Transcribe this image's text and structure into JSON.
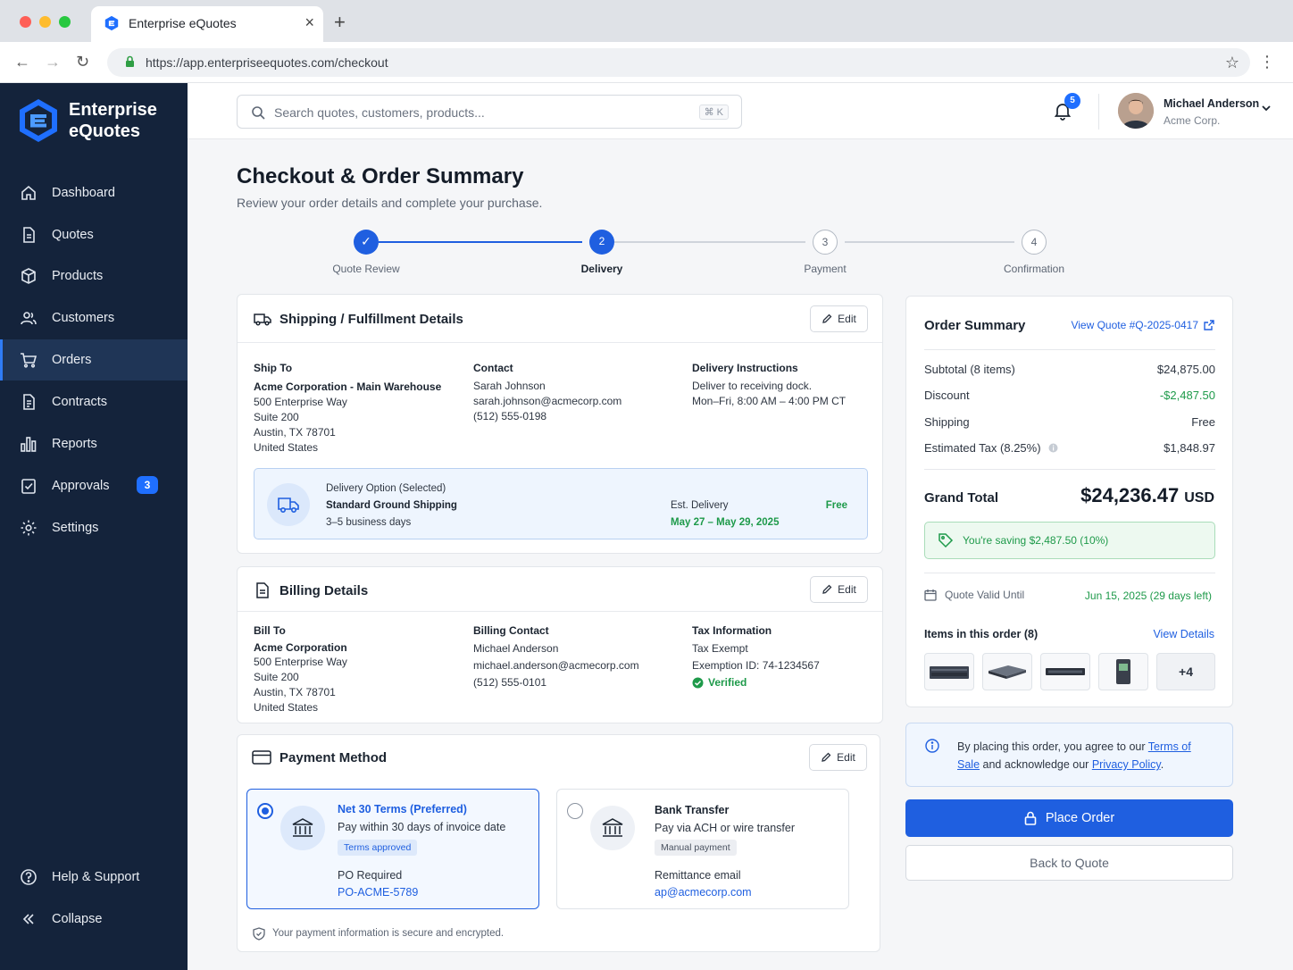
{
  "browser": {
    "tab_title": "Enterprise eQuotes",
    "url": "https://app.enterpriseequotes.com/checkout"
  },
  "sidebar": {
    "brand_line1": "Enterprise",
    "brand_line2": "eQuotes",
    "items": [
      {
        "label": "Dashboard",
        "icon": "home-icon"
      },
      {
        "label": "Quotes",
        "icon": "document-icon"
      },
      {
        "label": "Products",
        "icon": "box-icon"
      },
      {
        "label": "Customers",
        "icon": "users-icon"
      },
      {
        "label": "Orders",
        "icon": "cart-icon",
        "active": true
      },
      {
        "label": "Contracts",
        "icon": "contract-icon"
      },
      {
        "label": "Reports",
        "icon": "bar-chart-icon"
      },
      {
        "label": "Approvals",
        "icon": "approval-icon",
        "badge": "3"
      },
      {
        "label": "Settings",
        "icon": "gear-icon"
      }
    ],
    "help_label": "Help & Support",
    "collapse_label": "Collapse"
  },
  "header": {
    "search_placeholder": "Search quotes, customers, products...",
    "search_shortcut": "⌘ K",
    "notif_count": "5",
    "user_name": "Michael Anderson",
    "user_org": "Acme Corp."
  },
  "page": {
    "title": "Checkout & Order Summary",
    "subtitle": "Review your order details and complete your purchase."
  },
  "steps": [
    {
      "num": "✓",
      "label": "Quote Review",
      "state": "done"
    },
    {
      "num": "2",
      "label": "Delivery",
      "state": "active"
    },
    {
      "num": "3",
      "label": "Payment",
      "state": "todo"
    },
    {
      "num": "4",
      "label": "Confirmation",
      "state": "todo"
    }
  ],
  "shipping": {
    "title": "Shipping / Fulfillment Details",
    "edit_label": "Edit",
    "ship_to_label": "Ship To",
    "ship_to_name": "Acme Corporation - Main Warehouse",
    "ship_to_lines": [
      "500 Enterprise Way",
      "Suite 200",
      "Austin, TX 78701",
      "United States"
    ],
    "contact_label": "Contact",
    "contact_lines": [
      "Sarah Johnson",
      "sarah.johnson@acmecorp.com",
      "(512) 555-0198"
    ],
    "instructions_label": "Delivery Instructions",
    "instructions_lines": [
      "Deliver to receiving dock.",
      "Mon–Fri, 8:00 AM – 4:00 PM CT"
    ],
    "delivery_option_label": "Delivery Option (Selected)",
    "delivery_option_name": "Standard Ground Shipping",
    "delivery_option_time": "3–5 business days",
    "est_delivery_label": "Est. Delivery",
    "est_delivery_value": "May 27 – May 29, 2025",
    "delivery_price": "Free"
  },
  "billing": {
    "title": "Billing Details",
    "edit_label": "Edit",
    "bill_to_label": "Bill To",
    "bill_to_name": "Acme Corporation",
    "bill_to_lines": [
      "500 Enterprise Way",
      "Suite 200",
      "Austin, TX 78701",
      "United States"
    ],
    "contact_label": "Billing Contact",
    "contact_lines": [
      "Michael Anderson",
      "michael.anderson@acmecorp.com",
      "(512) 555-0101"
    ],
    "tax_label": "Tax Information",
    "tax_lines": [
      "Tax Exempt",
      "Exemption ID: 74-1234567"
    ],
    "tax_verified": "Verified"
  },
  "payment": {
    "title": "Payment Method",
    "edit_label": "Edit",
    "option1": {
      "title": "Net 30 Terms (Preferred)",
      "desc": "Pay within 30 days of invoice date",
      "pill": "Terms approved",
      "extra_label": "PO Required",
      "extra_value": "PO-ACME-5789"
    },
    "option2": {
      "title": "Bank Transfer",
      "desc": "Pay via ACH or wire transfer",
      "pill": "Manual payment",
      "extra_label": "Remittance email",
      "extra_value": "ap@acmecorp.com"
    },
    "secure_note": "Your payment information is secure and encrypted."
  },
  "summary": {
    "title": "Order Summary",
    "view_quote": "View Quote #Q-2025-0417",
    "rows": [
      {
        "label": "Subtotal (8 items)",
        "value": "$24,875.00"
      },
      {
        "label": "Discount",
        "value": "-$2,487.50"
      },
      {
        "label": "Shipping",
        "value": "Free"
      },
      {
        "label": "Estimated Tax (8.25%)",
        "value": "$1,848.97"
      }
    ],
    "grand_total_label": "Grand Total",
    "grand_total_value": "$24,236.47",
    "grand_total_currency": "USD",
    "saving_text": "You're saving $2,487.50 (10%)",
    "valid_label": "Quote Valid Until",
    "valid_value": "Jun 15, 2025 (29 days left)",
    "items_label": "Items in this order (8)",
    "view_details": "View Details",
    "more_items": "+4"
  },
  "terms": {
    "prefix": "By placing this order, you agree to our ",
    "terms_link": "Terms of Sale",
    "middle": " and acknowledge our ",
    "privacy_link": "Privacy Policy",
    "suffix": "."
  },
  "actions": {
    "place_order": "Place Order",
    "back_to_quote": "Back to Quote"
  },
  "colors": {
    "accent": "#1f5fe0",
    "sidebar_bg": "#14233b",
    "success": "#1e9a4a"
  }
}
